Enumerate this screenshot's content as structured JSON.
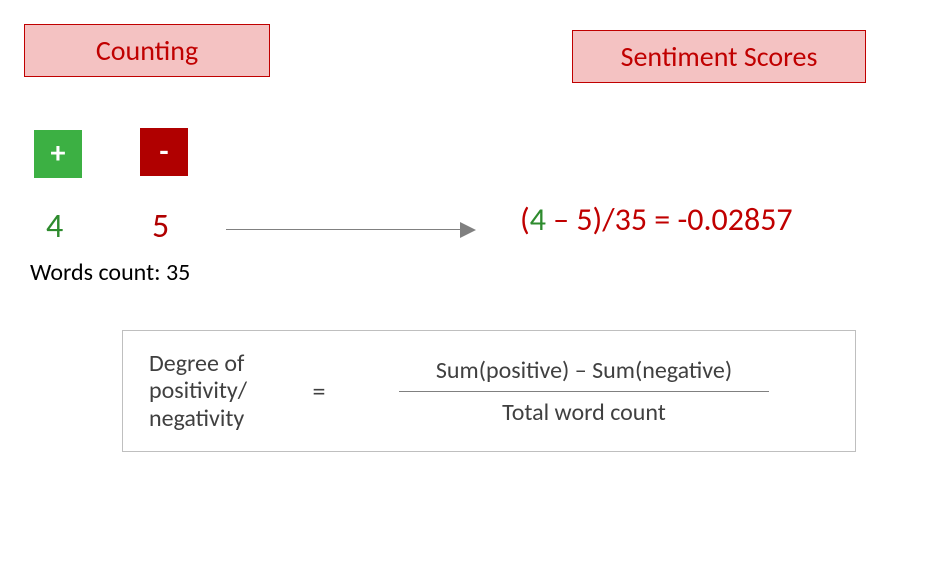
{
  "headers": {
    "counting": "Counting",
    "sentiment": "Sentiment Scores"
  },
  "tiles": {
    "plus": "+",
    "minus": "-"
  },
  "counts": {
    "positive": "4",
    "negative": "5",
    "wordLabel": "Words count: 35"
  },
  "equation": {
    "open": "(",
    "pos": "4",
    "mid": " – 5)/35 = -0.02857"
  },
  "formula": {
    "lhs1": "Degree of",
    "lhs2": "positivity/",
    "lhs3": "negativity",
    "equals": "=",
    "numerator": "Sum(positive) – Sum(negative)",
    "denominator": "Total word count"
  },
  "chart_data": {
    "type": "table",
    "positive_count": 4,
    "negative_count": 5,
    "total_words": 35,
    "sentiment_score": -0.02857,
    "formula": "(Sum(positive) - Sum(negative)) / Total word count",
    "computation": "(4 - 5) / 35 = -0.02857"
  }
}
